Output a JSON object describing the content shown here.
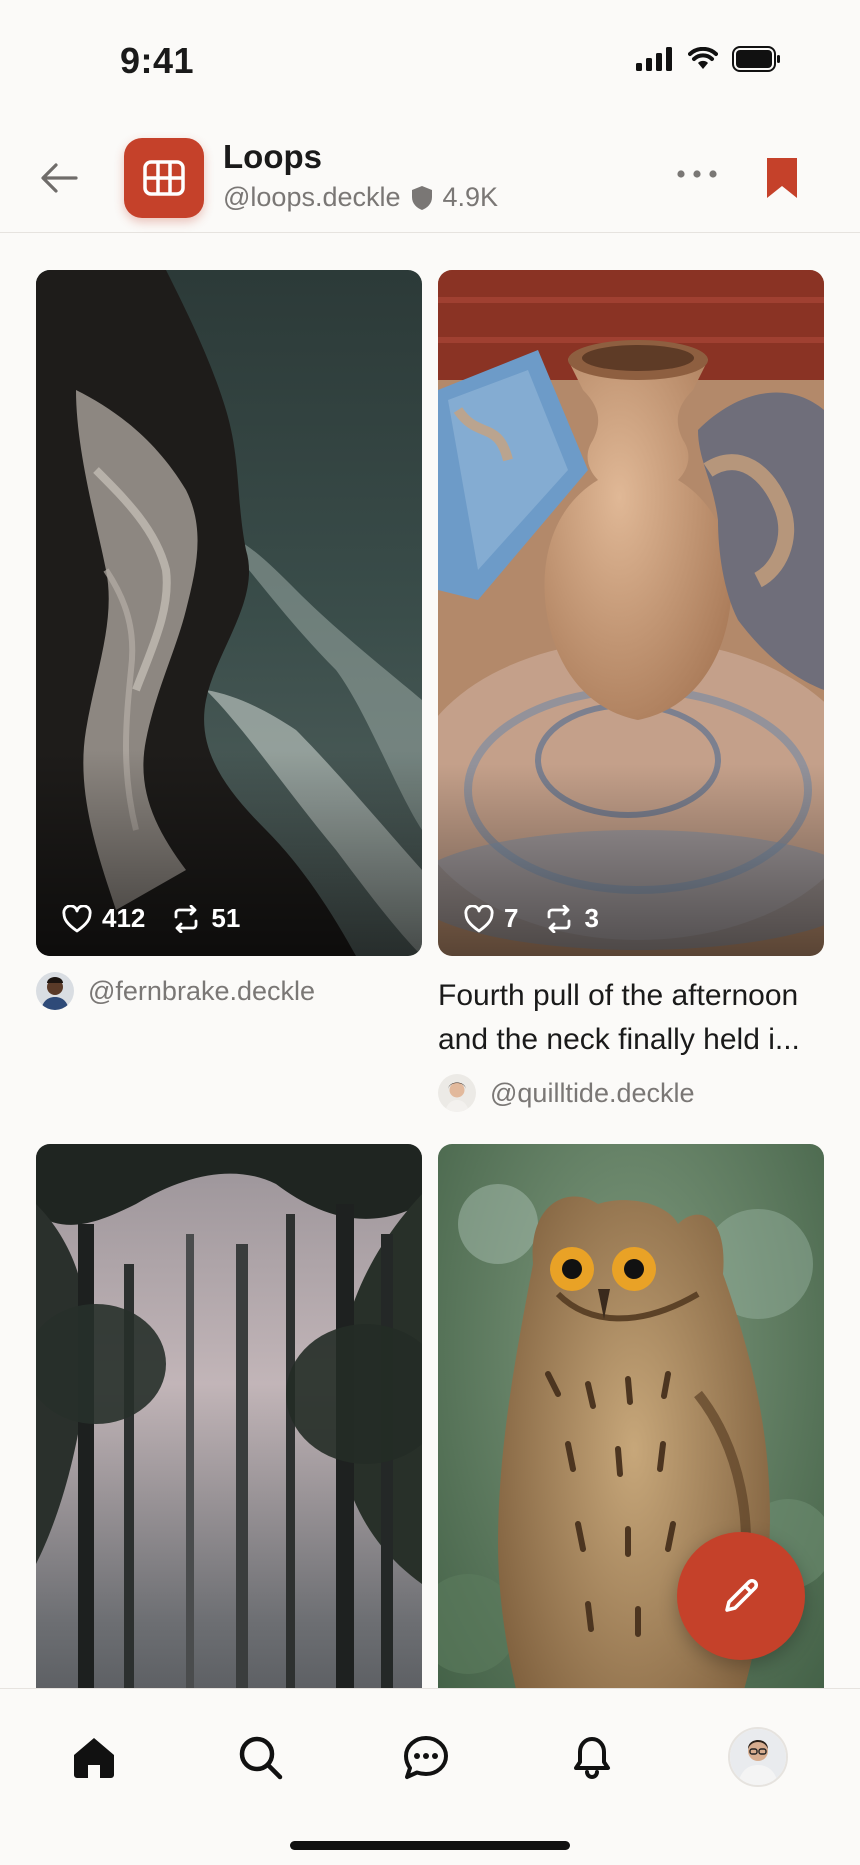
{
  "status_bar": {
    "time": "9:41"
  },
  "header": {
    "title": "Loops",
    "handle": "@loops.deckle",
    "followers": "4.9K",
    "icons": [
      "back-arrow-icon",
      "grid-icon",
      "shield-icon",
      "more-icon",
      "bookmark-icon"
    ]
  },
  "posts": [
    {
      "likes": "412",
      "reposts": "51",
      "caption": "",
      "author": "@fernbrake.deckle",
      "image": "sea-cliff-photo"
    },
    {
      "likes": "7",
      "reposts": "3",
      "caption": "Fourth pull of the afternoon and the neck finally held i...",
      "author": "@quilltide.deckle",
      "image": "pottery-wheel-photo"
    },
    {
      "image": "misty-forest-photo"
    },
    {
      "image": "owl-photo"
    }
  ],
  "fab": {
    "icon": "pencil-icon"
  },
  "tab_bar": {
    "tabs": [
      "home-icon",
      "search-icon",
      "messages-icon",
      "notifications-icon",
      "profile-avatar"
    ],
    "active": "home-icon"
  },
  "colors": {
    "accent": "#c5412a",
    "background": "#fbfaf8",
    "muted_text": "#7a7775"
  }
}
